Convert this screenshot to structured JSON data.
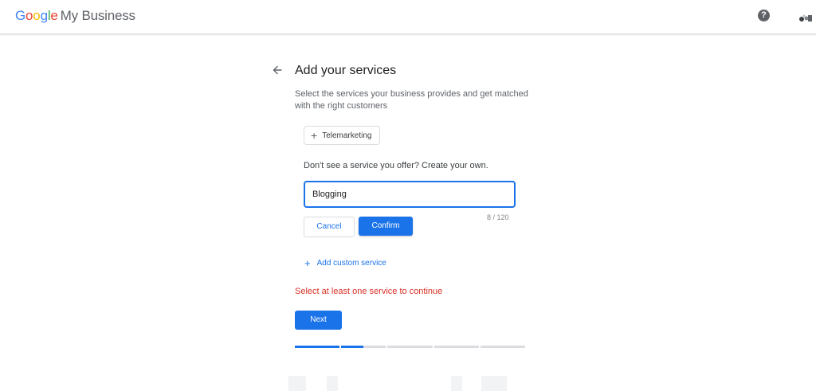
{
  "header": {
    "logo_letters": [
      "G",
      "o",
      "o",
      "g",
      "l",
      "e"
    ],
    "logo_suffix": "My Business",
    "help_icon": "help-circle-icon",
    "avatar_icon": "user-avatar"
  },
  "main": {
    "back_icon": "arrow-back-icon",
    "title": "Add your services",
    "description": "Select the services your business provides and get matched with the right customers",
    "suggested_services": [
      {
        "label": "Telemarketing",
        "icon": "plus-icon"
      }
    ],
    "custom_prompt": "Don't see a service you offer? Create your own.",
    "custom_input": {
      "value": "Blogging",
      "char_count": "8 / 120"
    },
    "cancel_label": "Cancel",
    "confirm_label": "Confirm",
    "add_custom_label": "Add custom service",
    "error_message": "Select at least one service to continue",
    "next_label": "Next",
    "progress": {
      "steps": 5,
      "step_fill": [
        1,
        0.5,
        0,
        0,
        0
      ]
    }
  },
  "colors": {
    "accent": "#1a73e8",
    "error": "#d93025",
    "text_primary": "#202124",
    "text_secondary": "#5f6368",
    "border": "#dadce0"
  }
}
